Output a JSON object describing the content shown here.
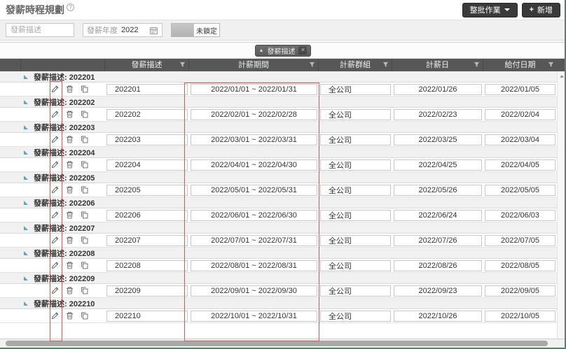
{
  "page": {
    "title": "發薪時程規劃",
    "help": "?"
  },
  "toolbar": {
    "batch": "整批作業",
    "add": "新增",
    "plus": "+"
  },
  "filters": {
    "desc_placeholder": "發薪描述",
    "year_label": "發薪年度",
    "year_value": "2022",
    "lock_label": "未鎖定"
  },
  "grouping": {
    "arrow": "▲",
    "chip": "發薪描述",
    "remove": "×"
  },
  "table": {
    "headers": [
      "發薪描述",
      "計薪期間",
      "計薪群組",
      "計薪日",
      "給付日期"
    ],
    "group_prefix": "發薪描述: ",
    "rows": [
      {
        "desc": "202201",
        "period": "2022/01/01 ~ 2022/01/31",
        "group": "全公司",
        "calc_date": "2022/01/26",
        "pay_date": "2022/01/05"
      },
      {
        "desc": "202202",
        "period": "2022/02/01 ~ 2022/02/28",
        "group": "全公司",
        "calc_date": "2022/02/23",
        "pay_date": "2022/02/04"
      },
      {
        "desc": "202203",
        "period": "2022/03/01 ~ 2022/03/31",
        "group": "全公司",
        "calc_date": "2022/03/25",
        "pay_date": "2022/03/04"
      },
      {
        "desc": "202204",
        "period": "2022/04/01 ~ 2022/04/30",
        "group": "全公司",
        "calc_date": "2022/04/25",
        "pay_date": "2022/04/05"
      },
      {
        "desc": "202205",
        "period": "2022/05/01 ~ 2022/05/31",
        "group": "全公司",
        "calc_date": "2022/05/26",
        "pay_date": "2022/05/05"
      },
      {
        "desc": "202206",
        "period": "2022/06/01 ~ 2022/06/30",
        "group": "全公司",
        "calc_date": "2022/06/24",
        "pay_date": "2022/06/03"
      },
      {
        "desc": "202207",
        "period": "2022/07/01 ~ 2022/07/31",
        "group": "全公司",
        "calc_date": "2022/07/26",
        "pay_date": "2022/07/05"
      },
      {
        "desc": "202208",
        "period": "2022/08/01 ~ 2022/08/31",
        "group": "全公司",
        "calc_date": "2022/08/26",
        "pay_date": "2022/08/05"
      },
      {
        "desc": "202209",
        "period": "2022/09/01 ~ 2022/09/30",
        "group": "全公司",
        "calc_date": "2022/09/23",
        "pay_date": "2022/09/05"
      },
      {
        "desc": "202210",
        "period": "2022/10/01 ~ 2022/10/31",
        "group": "全公司",
        "calc_date": "2022/10/26",
        "pay_date": "2022/10/05"
      }
    ]
  },
  "colors": {
    "annotation_red": "#e25555",
    "header_bg": "#575757",
    "button_bg": "#3a3a3a",
    "group_triangle": "#57a8c4",
    "edge_green": "#4a8a63"
  }
}
